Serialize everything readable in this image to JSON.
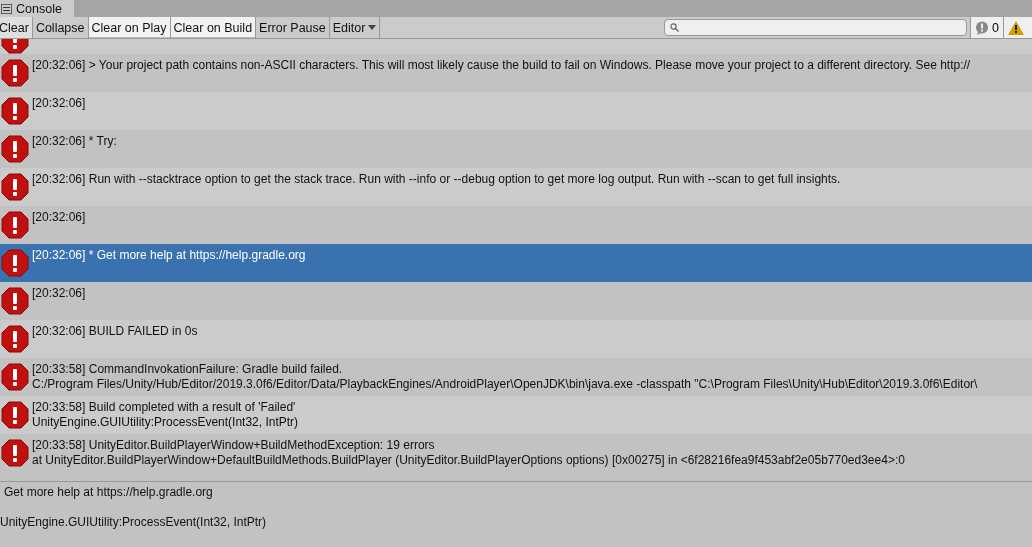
{
  "window": {
    "title": "Console"
  },
  "toolbar": [
    {
      "label": "Clear",
      "kind": "button"
    },
    {
      "label": "Collapse",
      "kind": "toggle",
      "on": false
    },
    {
      "label": "Clear on Play",
      "kind": "toggle",
      "on": true
    },
    {
      "label": "Clear on Build",
      "kind": "toggle",
      "on": true
    },
    {
      "label": "Error Pause",
      "kind": "toggle",
      "on": false
    },
    {
      "label": "Editor",
      "kind": "dropdown"
    }
  ],
  "counters": [
    {
      "kind": "info",
      "count": "0"
    },
    {
      "kind": "warning"
    }
  ],
  "log": [
    {
      "selected": false,
      "partial": true
    },
    {
      "lines": [
        "[20:32:06]    > Your project path contains non-ASCII characters. This will most likely cause the build to fail on Windows. Please move your project to a different directory. See http://"
      ],
      "selected": false
    },
    {
      "lines": [
        "[20:32:06]"
      ],
      "selected": false
    },
    {
      "lines": [
        "[20:32:06] * Try:"
      ],
      "selected": false
    },
    {
      "lines": [
        "[20:32:06] Run with --stacktrace option to get the stack trace. Run with --info or --debug option to get more log output. Run with --scan to get full insights."
      ],
      "selected": false
    },
    {
      "lines": [
        "[20:32:06]"
      ],
      "selected": false
    },
    {
      "lines": [
        "[20:32:06] * Get more help at https://help.gradle.org"
      ],
      "selected": true
    },
    {
      "lines": [
        "[20:32:06]"
      ],
      "selected": false
    },
    {
      "lines": [
        "[20:32:06] BUILD FAILED in 0s"
      ],
      "selected": false
    },
    {
      "lines": [
        "[20:33:58] CommandInvokationFailure: Gradle build failed.",
        "C:/Program Files/Unity/Hub/Editor/2019.3.0f6/Editor/Data/PlaybackEngines/AndroidPlayer\\OpenJDK\\bin\\java.exe -classpath \"C:\\Program Files\\Unity\\Hub\\Editor\\2019.3.0f6\\Editor\\"
      ],
      "selected": false
    },
    {
      "lines": [
        "[20:33:58] Build completed with a result of 'Failed'",
        "UnityEngine.GUIUtility:ProcessEvent(Int32, IntPtr)"
      ],
      "selected": false
    },
    {
      "lines": [
        "[20:33:58] UnityEditor.BuildPlayerWindow+BuildMethodException: 19 errors",
        "  at UnityEditor.BuildPlayerWindow+DefaultBuildMethods.BuildPlayer (UnityEditor.BuildPlayerOptions options) [0x00275] in <6f28216fea9f453abf2e05b770ed3ee4>:0"
      ],
      "selected": false
    }
  ],
  "detail": [
    "Get more help at https://help.gradle.org",
    "UnityEngine.GUIUtility:ProcessEvent(Int32, IntPtr)"
  ]
}
